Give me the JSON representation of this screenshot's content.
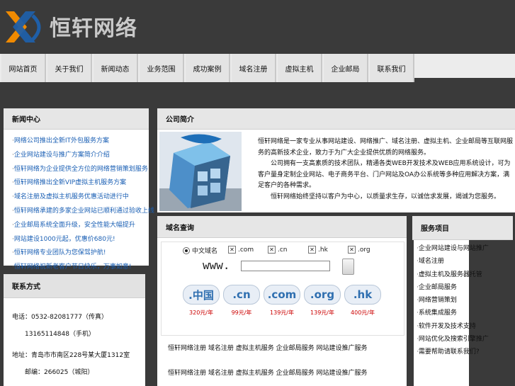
{
  "brand": {
    "name": "恒轩网络"
  },
  "nav": {
    "items": [
      "网站首页",
      "关于我们",
      "新闻动态",
      "业务范围",
      "成功案例",
      "域名注册",
      "虚拟主机",
      "企业邮局",
      "联系我们"
    ]
  },
  "news": {
    "title": "新闻中心",
    "items": [
      "网络公司推出全新IT外包服务方案",
      "企业网站建设与推广方案简介介绍",
      "恒轩网络为企业提供全方位的网络营销策划服务",
      "恒轩网络推出全新VIP虚拟主机服务方案",
      "域名注册及虚拟主机服务优惠活动进行中",
      "恒轩网络承建的多家企业网站已顺利通过验收上线",
      "企业邮局系统全面升级，安全性能大幅提升",
      "网站建设1000元起，优惠价680元!",
      "恒轩网络专业团队为您保驾护航!",
      "恒轩网络祝新老客户节日快乐，万事如意!"
    ]
  },
  "contact": {
    "title": "联系方式",
    "lines": [
      "电话：0532-82081777（传真）",
      "13165114848（手机）",
      "地址：青岛市市南区228号某大厦1312室",
      "邮编：266025（城阳）"
    ]
  },
  "about": {
    "title": "公司简介",
    "paragraphs": [
      "恒轩网络是一家专业从事网站建设、网络推广、域名注册、虚拟主机、企业邮局等互联网服务的高新技术企业，致力于为广大企业提供优质的网络服务。",
      "　　公司拥有一支高素质的技术团队，精通各类WEB开发技术及WEB应用系统设计，可为客户量身定制企业网站、电子商务平台、门户网站及OA办公系统等多种应用解决方案，满足客户的各种需求。",
      "　　恒轩网络始终坚持以客户为中心，以质量求生存，以诚信求发展，竭诚为您服务。"
    ]
  },
  "domain": {
    "title": "域名查询",
    "prefix": "www.",
    "options": [
      {
        "label": "中文域名",
        "type": "radio",
        "checked": true
      },
      {
        "label": ".com",
        "type": "checkbox",
        "checked": true
      },
      {
        "label": ".cn",
        "type": "checkbox",
        "checked": true
      },
      {
        "label": ".hk",
        "type": "checkbox",
        "checked": true
      },
      {
        "label": ".org",
        "type": "checkbox",
        "checked": true
      }
    ],
    "input": {
      "value": "",
      "placeholder": ""
    },
    "prices": [
      {
        "tld": ".中国",
        "price": "320元/年"
      },
      {
        "tld": ".cn",
        "price": "99元/年"
      },
      {
        "tld": ".com",
        "price": "139元/年"
      },
      {
        "tld": ".org",
        "price": "139元/年"
      },
      {
        "tld": ".hk",
        "price": "400元/年"
      }
    ],
    "notes": [
      "恒轩网络注册 域名注册 虚拟主机服务 企业邮局服务 网站建设推广服务",
      "恒轩网络注册 域名注册 虚拟主机服务 企业邮局服务 网站建设推广服务"
    ]
  },
  "services": {
    "title": "服务项目",
    "items": [
      "企业网站建设与网站推广",
      "域名注册",
      "虚拟主机及服务器托管",
      "企业邮局服务",
      "网络营销策划",
      "系统集成服务",
      "软件开发及技术支持",
      "网站优化及搜索引擎推广",
      "需要帮助请联系我们?"
    ]
  },
  "colors": {
    "bg": "#3a3a3a",
    "link": "#1a5fb4",
    "price": "#cc0000",
    "logo_orange": "#f08a00",
    "logo_blue": "#1f5fa8"
  }
}
